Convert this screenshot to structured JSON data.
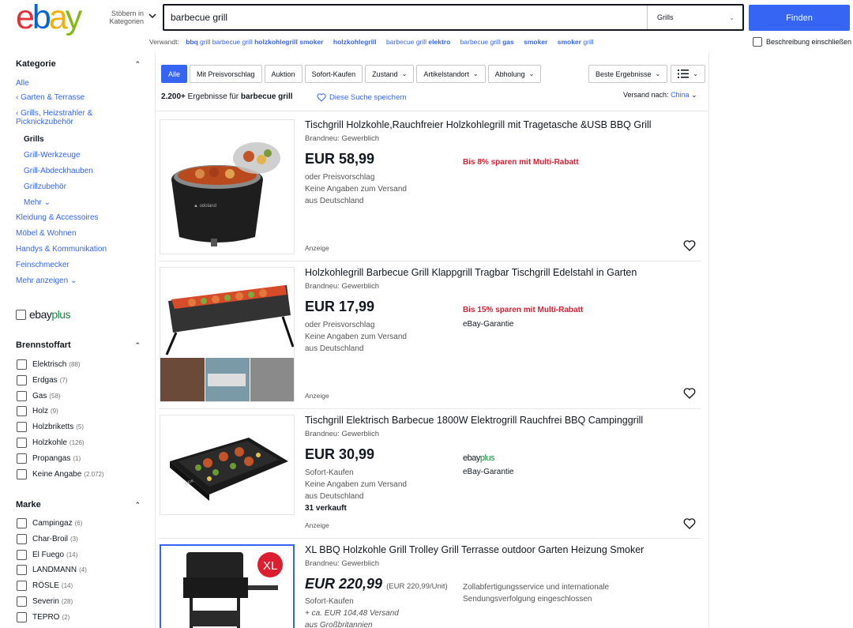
{
  "header": {
    "logo": [
      "e",
      "b",
      "a",
      "y"
    ],
    "browse_label_1": "Stöbern in",
    "browse_label_2": "Kategorien",
    "search_value": "barbecue grill",
    "search_category": "Grills",
    "find_button": "Finden",
    "description_checkbox": "Beschreibung einschließen"
  },
  "related": {
    "label": "Verwandt:",
    "items": [
      {
        "normal": "",
        "bold": "bbq",
        "rest": " grill barbecue grill ",
        "bold2": "holzkohlegrill smoker"
      },
      {
        "normal": "",
        "bold": "holzkohlegrill",
        "rest": "",
        "bold2": ""
      },
      {
        "normal": "barbecue grill ",
        "bold": "elektro",
        "rest": "",
        "bold2": ""
      },
      {
        "normal": "barbecue grill ",
        "bold": "gas",
        "rest": "",
        "bold2": ""
      },
      {
        "normal": "",
        "bold": "smoker",
        "rest": "",
        "bold2": ""
      },
      {
        "normal": "",
        "bold": "smoker",
        "rest": " grill",
        "bold2": ""
      }
    ]
  },
  "sidebar": {
    "category_title": "Kategorie",
    "all": "Alle",
    "crumb1": "Garten & Terrasse",
    "crumb2a": "Grills, Heizstrahler &",
    "crumb2b": "Picknickzubehör",
    "current": "Grills",
    "sub": [
      "Grill-Werkzeuge",
      "Grill-Abdeckhauben",
      "Grillzubehör"
    ],
    "more_sub": "Mehr",
    "cats": [
      "Kleidung & Accessoires",
      "Möbel & Wohnen",
      "Handys & Kommunikation",
      "Feinschmecker"
    ],
    "more_cats": "Mehr anzeigen",
    "ebayplus": {
      "e": "ebay",
      "p": "plus"
    },
    "fuel_title": "Brennstoffart",
    "fuel": [
      {
        "label": "Elektrisch",
        "count": "(88)"
      },
      {
        "label": "Erdgas",
        "count": "(7)"
      },
      {
        "label": "Gas",
        "count": "(58)"
      },
      {
        "label": "Holz",
        "count": "(9)"
      },
      {
        "label": "Holzbriketts",
        "count": "(5)"
      },
      {
        "label": "Holzkohle",
        "count": "(126)"
      },
      {
        "label": "Propangas",
        "count": "(1)"
      },
      {
        "label": "Keine Angabe",
        "count": "(2.072)"
      }
    ],
    "brand_title": "Marke",
    "brands": [
      {
        "label": "Campingaz",
        "count": "(6)"
      },
      {
        "label": "Char-Broil",
        "count": "(3)"
      },
      {
        "label": "El Fuego",
        "count": "(14)"
      },
      {
        "label": "LANDMANN",
        "count": "(4)"
      },
      {
        "label": "RÖSLE",
        "count": "(14)"
      },
      {
        "label": "Severin",
        "count": "(28)"
      },
      {
        "label": "TEPRO",
        "count": "(2)"
      }
    ]
  },
  "filters": {
    "chips": [
      "Alle",
      "Mit Preisvorschlag",
      "Auktion",
      "Sofort-Kaufen"
    ],
    "dropdowns": [
      "Zustand",
      "Artikelstandort",
      "Abholung"
    ],
    "sort": "Beste Ergebnisse"
  },
  "results": {
    "count": "2.200+",
    "count_text": " Ergebnisse für ",
    "query": "barbecue grill",
    "save_search": "Diese Suche speichern",
    "ship_to_label": "Versand nach:",
    "ship_to_value": "China"
  },
  "items": [
    {
      "title": "Tischgrill Holzkohle,Rauchfreier Holzkohlegrill mit Tragetasche &USB BBQ Grill",
      "condition": "Brandneu: Gewerblich",
      "price": "EUR 58,99",
      "lines": [
        "oder Preisvorschlag",
        "Keine Angaben zum Versand",
        "aus Deutschland"
      ],
      "promo": "Bis 8% sparen mit Multi-Rabatt",
      "extra": "",
      "ad": "Anzeige"
    },
    {
      "title": "Holzkohlegrill Barbecue Grill Klappgrill Tragbar Tischgrill Edelstahl in Garten",
      "condition": "Brandneu: Gewerblich",
      "price": "EUR 17,99",
      "lines": [
        "oder Preisvorschlag",
        "Keine Angaben zum Versand",
        "aus Deutschland"
      ],
      "promo": "Bis 15% sparen mit Multi-Rabatt",
      "extra": "eBay-Garantie",
      "ad": "Anzeige"
    },
    {
      "title": "Tischgrill Elektrisch Barbecue 1800W Elektrogrill Rauchfrei BBQ Campinggrill",
      "condition": "Brandneu: Gewerblich",
      "price": "EUR 30,99",
      "lines": [
        "Sofort-Kaufen",
        "Keine Angaben zum Versand",
        "aus Deutschland"
      ],
      "sold": "31 verkauft",
      "ebayplus": {
        "e": "ebay",
        "p": "plus"
      },
      "extra": "eBay-Garantie",
      "ad": "Anzeige"
    },
    {
      "title": "XL BBQ Holzkohle Grill Trolley Grill Terrasse outdoor Garten Heizung Smoker",
      "condition": "Brandneu: Gewerblich",
      "price": "EUR 220,99",
      "unit_price": "(EUR 220,99/Unit)",
      "lines": [
        "Sofort-Kaufen",
        "+ ca. EUR 104,48 Versand",
        "aus Großbritannien"
      ],
      "extra_1": "Zollabfertigungsservice und internationale",
      "extra_2": "Sendungsverfolgung eingeschlossen",
      "badge": "XL"
    }
  ]
}
